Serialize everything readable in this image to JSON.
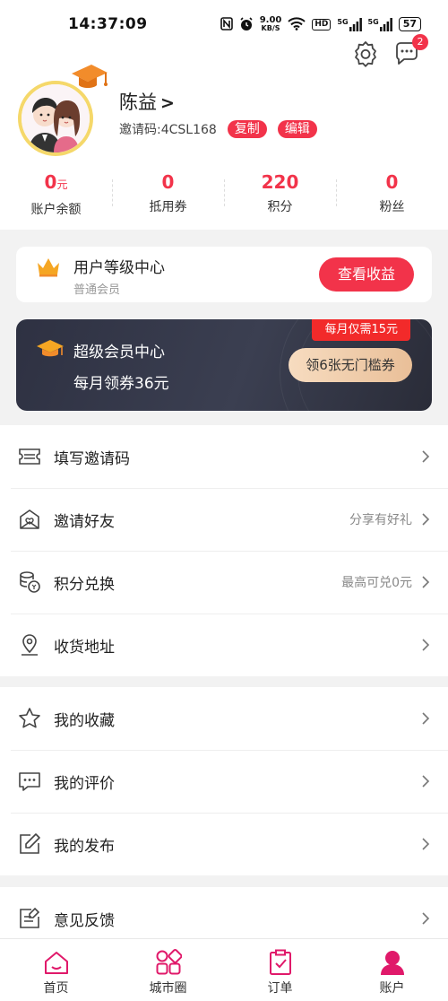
{
  "status_bar": {
    "time": "14:37:09",
    "net_speed_value": "9.00",
    "net_speed_unit": "KB/S",
    "hd_label": "HD",
    "signal1_label": "5G",
    "signal2_label": "5G",
    "battery": "57"
  },
  "header": {
    "settings_icon": "gear-icon",
    "message_icon": "message-icon",
    "message_badge": "2"
  },
  "profile": {
    "name": "陈益",
    "name_arrow": ">",
    "invite_code_text": "邀请码:4CSL168",
    "copy_label": "复制",
    "edit_label": "编辑"
  },
  "stats": [
    {
      "value": "0",
      "unit": "元",
      "label": "账户余额"
    },
    {
      "value": "0",
      "unit": "",
      "label": "抵用券"
    },
    {
      "value": "220",
      "unit": "",
      "label": "积分"
    },
    {
      "value": "0",
      "unit": "",
      "label": "粉丝"
    }
  ],
  "level_card": {
    "title": "用户等级中心",
    "subtitle": "普通会员",
    "button": "查看收益"
  },
  "vip_card": {
    "title": "超级会员中心",
    "subtitle": "每月领券36元",
    "tag": "每月仅需15元",
    "button": "领6张无门槛券"
  },
  "menu_group_1": [
    {
      "label": "填写邀请码",
      "extra": "",
      "icon": "ticket-icon"
    },
    {
      "label": "邀请好友",
      "extra": "分享有好礼",
      "icon": "invite-envelope-icon"
    },
    {
      "label": "积分兑换",
      "extra": "最高可兑0元",
      "icon": "coins-icon"
    },
    {
      "label": "收货地址",
      "extra": "",
      "icon": "location-pin-icon"
    }
  ],
  "menu_group_2": [
    {
      "label": "我的收藏",
      "extra": "",
      "icon": "star-icon"
    },
    {
      "label": "我的评价",
      "extra": "",
      "icon": "comment-icon"
    },
    {
      "label": "我的发布",
      "extra": "",
      "icon": "edit-note-icon"
    }
  ],
  "menu_group_3": [
    {
      "label": "意见反馈",
      "extra": "",
      "icon": "feedback-icon"
    }
  ],
  "tabs": [
    {
      "label": "首页",
      "icon": "home-icon"
    },
    {
      "label": "城市圈",
      "icon": "grid-icon"
    },
    {
      "label": "订单",
      "icon": "clipboard-check-icon"
    },
    {
      "label": "账户",
      "icon": "user-icon",
      "active": true
    }
  ],
  "colors": {
    "accent": "#f2334a",
    "tab_icon": "#e0196a",
    "vip_bg": "#333646",
    "vip_button": "#efcfae",
    "avatar_ring": "#f5d86a",
    "crown": "#f5a623"
  }
}
